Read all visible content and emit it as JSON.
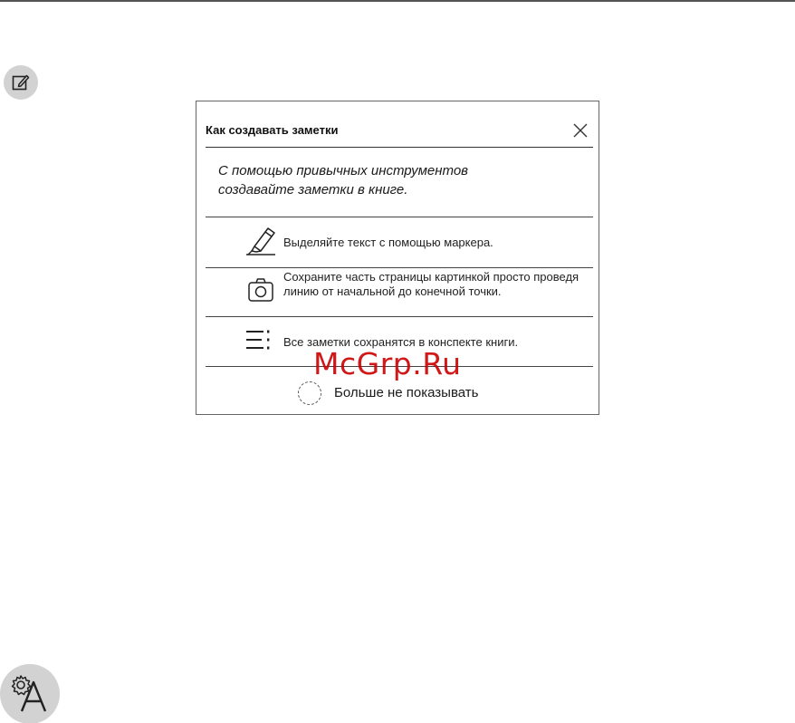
{
  "dialog": {
    "title": "Как создавать заметки",
    "intro_line1": "С помощью привычных инструментов",
    "intro_line2": "создавайте заметки в книге.",
    "rows": [
      {
        "icon": "marker-icon",
        "text": "Выделяйте текст с помощью маркера."
      },
      {
        "icon": "camera-icon",
        "text": "Сохраните часть страницы картинкой просто проведя линию от начальной до конечной точки."
      },
      {
        "icon": "notes-list-icon",
        "text": "Все заметки сохранятся в конспекте книги."
      }
    ],
    "dont_show_label": "Больше не показывать"
  },
  "watermark": "McGrp.Ru",
  "colors": {
    "badge": "#d2d2d2",
    "watermark": "#cc0000",
    "rule": "#555555"
  }
}
